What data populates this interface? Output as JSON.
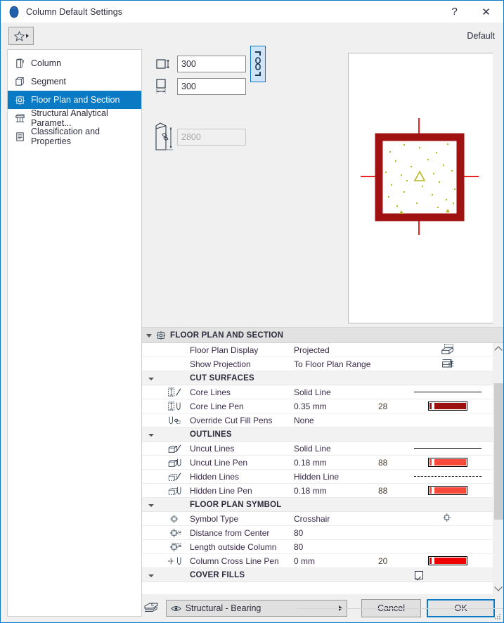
{
  "window": {
    "title": "Column Default Settings",
    "app_icon": "archicad-column-icon",
    "help_label": "?",
    "close_label": "✕",
    "accent_color": "#0a7ac4"
  },
  "toolbar": {
    "favorites_icon": "star-icon",
    "favorites_dropdown_icon": "triangle-right-icon",
    "default_label": "Default"
  },
  "sidebar": {
    "items": [
      {
        "label": "Column",
        "icon": "column-icon",
        "active": false
      },
      {
        "label": "Segment",
        "icon": "segment-box-icon",
        "active": false
      },
      {
        "label": "Floor Plan and Section",
        "icon": "floor-plan-section-icon",
        "active": true
      },
      {
        "label": "Structural Analytical Paramet...",
        "icon": "structural-analytical-icon",
        "active": false
      },
      {
        "label": "Classification and Properties",
        "icon": "classification-properties-icon",
        "active": false
      }
    ]
  },
  "geometry": {
    "fields": [
      {
        "name": "depth",
        "icon": "square-vertical-dim-icon",
        "value": "300",
        "disabled": false
      },
      {
        "name": "width",
        "icon": "square-horizontal-dim-icon",
        "value": "300",
        "disabled": false
      },
      {
        "name": "height",
        "icon": "column-height-icon",
        "value": "2800",
        "disabled": true
      }
    ],
    "link_button": {
      "icon": "chain-link-icon",
      "active": true
    }
  },
  "preview": {
    "name": "column-floor-plan-preview",
    "outline_color": "#a01212",
    "crosshair_color": "#ee2222",
    "fill_pattern_color": "#b8b81f",
    "background": "#ffffff"
  },
  "settings_panel": {
    "section_title": "FLOOR PLAN AND SECTION",
    "section_icon": "floor-plan-section-icon",
    "rows": [
      {
        "type": "item",
        "icon": "",
        "label": "Floor Plan Display",
        "value": "Projected",
        "pen": "",
        "extra": "icon",
        "extra_icon": "projected-display-icon"
      },
      {
        "type": "item",
        "icon": "",
        "label": "Show Projection",
        "value": "To Floor Plan Range",
        "pen": "",
        "extra": "icon",
        "extra_icon": "floor-plan-range-icon"
      },
      {
        "type": "group",
        "icon": "",
        "label": "CUT SURFACES",
        "value": "",
        "pen": "",
        "extra": "none",
        "extra_icon": ""
      },
      {
        "type": "item",
        "icon": "core-line-type-icon",
        "label": "Core Lines",
        "value": "Solid Line",
        "pen": "",
        "extra": "line-solid",
        "extra_icon": ""
      },
      {
        "type": "item",
        "icon": "core-line-pen-icon",
        "label": "Core Line Pen",
        "value": "0.35 mm",
        "pen": "28",
        "extra": "pen",
        "extra_icon": "",
        "pen_color": "#9d1010"
      },
      {
        "type": "item",
        "icon": "override-cut-fill-icon",
        "label": "Override Cut Fill Pens",
        "value": "None",
        "pen": "",
        "extra": "none",
        "extra_icon": ""
      },
      {
        "type": "group",
        "icon": "",
        "label": "OUTLINES",
        "value": "",
        "pen": "",
        "extra": "none",
        "extra_icon": ""
      },
      {
        "type": "item",
        "icon": "uncut-line-type-icon",
        "label": "Uncut Lines",
        "value": "Solid Line",
        "pen": "",
        "extra": "line-solid",
        "extra_icon": ""
      },
      {
        "type": "item",
        "icon": "uncut-line-pen-icon",
        "label": "Uncut Line Pen",
        "value": "0.18 mm",
        "pen": "88",
        "extra": "pen",
        "extra_icon": "",
        "pen_color": "#f9493a"
      },
      {
        "type": "item",
        "icon": "hidden-line-type-icon",
        "label": "Hidden Lines",
        "value": "Hidden Line",
        "pen": "",
        "extra": "line-dashed",
        "extra_icon": ""
      },
      {
        "type": "item",
        "icon": "hidden-line-pen-icon",
        "label": "Hidden Line Pen",
        "value": "0.18 mm",
        "pen": "88",
        "extra": "pen",
        "extra_icon": "",
        "pen_color": "#f9493a"
      },
      {
        "type": "group",
        "icon": "",
        "label": "FLOOR PLAN SYMBOL",
        "value": "",
        "pen": "",
        "extra": "none",
        "extra_icon": ""
      },
      {
        "type": "item",
        "icon": "crosshair-symbol-icon",
        "label": "Symbol Type",
        "value": "Crosshair",
        "pen": "",
        "extra": "icon",
        "extra_icon": "crosshair-symbol-icon"
      },
      {
        "type": "item",
        "icon": "distance-center-icon",
        "label": "Distance from Center",
        "value": "80",
        "pen": "",
        "extra": "none",
        "extra_icon": ""
      },
      {
        "type": "item",
        "icon": "length-outside-icon",
        "label": "Length outside Column",
        "value": "80",
        "pen": "",
        "extra": "none",
        "extra_icon": ""
      },
      {
        "type": "item",
        "icon": "cross-line-pen-icon",
        "label": "Column Cross Line Pen",
        "value": "0 mm",
        "pen": "20",
        "extra": "pen",
        "extra_icon": "",
        "pen_color": "#ee0000"
      },
      {
        "type": "group",
        "icon": "",
        "label": "COVER FILLS",
        "value": "",
        "pen": "",
        "extra": "checkbox",
        "extra_icon": "",
        "checked": true
      }
    ],
    "scrollbar": {
      "up_icon": "chevron-up-icon",
      "down_icon": "chevron-down-icon"
    }
  },
  "footer": {
    "layer_icon": "layers-icon",
    "layer_eye_icon": "eye-icon",
    "layer_value": "Structural - Bearing",
    "layer_dropdown_icon": "triangle-right-icon",
    "cancel_label": "Cancel",
    "ok_label": "OK",
    "resize_grip_icon": "resize-grip-icon"
  }
}
